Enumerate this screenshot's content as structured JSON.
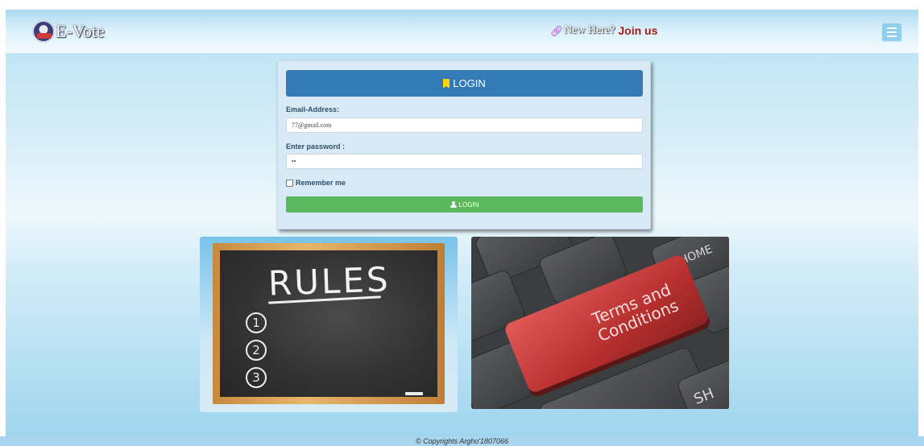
{
  "navbar": {
    "brand": "E-Vote",
    "new_here_text": "New Here?",
    "join_label": "Join us",
    "menu_icon": "hamburger-icon",
    "link_icon": "link-icon"
  },
  "login": {
    "title": "LOGIN",
    "title_icon": "bookmark-icon",
    "email_label": "Email-Address:",
    "email_value": "77@gmail.com",
    "password_label": "Enter password :",
    "password_value": "••",
    "remember_label": "Remember me",
    "submit_label": "LOGIN",
    "submit_icon": "user-icon"
  },
  "rules_card": {
    "title": "RULES",
    "items": [
      "1",
      "2",
      "3"
    ]
  },
  "terms_card": {
    "key_text": "Terms and Conditions",
    "home_key": "HOME",
    "shift_key": "SH"
  },
  "footer": {
    "text": "© Copyrights Argho'1807066"
  },
  "colors": {
    "primary": "#337ab7",
    "success": "#5cb85c",
    "join_link": "#a51c1c"
  }
}
